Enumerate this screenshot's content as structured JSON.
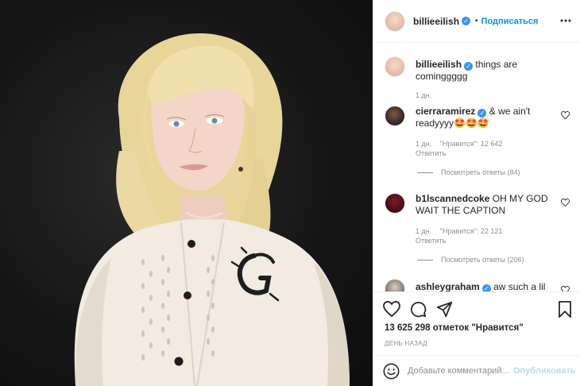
{
  "header": {
    "username": "billieeilish",
    "dot": "•",
    "follow_label": "Подписаться"
  },
  "caption": {
    "username": "billieeilish",
    "text": "things are cominggggg",
    "time": "1 дн."
  },
  "comments": [
    {
      "username": "cierraramirez",
      "text": "& we ain't readyyyy🤩🤩🤩",
      "time": "1 дн.",
      "likes": "\"Нравится\": 12 642",
      "reply_label": "Ответить",
      "view_replies": "Посмотреть ответы (84)"
    },
    {
      "username": "b1lscannedcoke",
      "text": "OH MY GOD WAIT THE CAPTION",
      "time": "1 дн.",
      "likes": "\"Нравится\": 22 121",
      "reply_label": "Ответить",
      "view_replies": "Посмотреть ответы (206)"
    },
    {
      "username": "ashleygraham",
      "text": "aw such a lil"
    }
  ],
  "actions": {
    "likes_count": "13 625 298 отметок \"Нравится\"",
    "time_ago": "ДЕНЬ НАЗАД"
  },
  "add_comment": {
    "placeholder": "Добавьте комментарий...",
    "publish_label": "Опубликовать"
  },
  "icons": [
    "heart-icon",
    "comment-icon",
    "share-icon",
    "bookmark-icon",
    "more-icon",
    "emoji-icon",
    "verified-icon"
  ],
  "colors": {
    "accent": "#0095f6",
    "verified": "#3897f0",
    "muted": "#8e8e8e",
    "text": "#262626",
    "publish_disabled": "#b3dbff"
  }
}
